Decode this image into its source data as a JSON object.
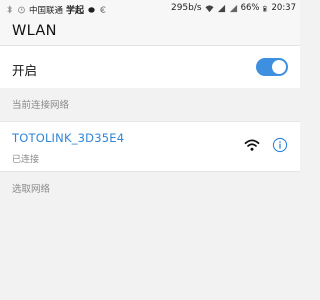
{
  "status_bar": {
    "carrier": "中国联通",
    "app_name": "学起",
    "speed": "295b/s",
    "battery": "66%",
    "time": "20:37",
    "icons": [
      "bluetooth-icon",
      "alarm-icon",
      "dot-icon",
      "euro-icon",
      "wifi-signal-icon",
      "cell-signal-icon",
      "battery-icon"
    ]
  },
  "app_bar": {
    "title": "WLAN"
  },
  "wlan_toggle": {
    "label": "开启",
    "on": true,
    "accent_color": "#3d8fe0"
  },
  "sections": {
    "connected": {
      "header": "当前连接网络"
    },
    "select": {
      "header": "选取网络"
    }
  },
  "connected_network": {
    "ssid": "TOTOLINK_3D35E4",
    "status": "已连接",
    "icons": [
      "wifi-icon",
      "info-icon"
    ]
  }
}
